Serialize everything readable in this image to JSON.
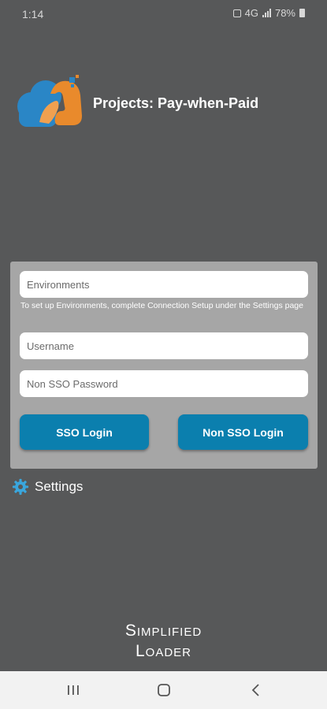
{
  "status_bar": {
    "time": "1:14",
    "signal_text": "4G",
    "battery": "78%"
  },
  "header": {
    "title": "Projects: Pay-when-Paid"
  },
  "login": {
    "environments_placeholder": "Environments",
    "hint": "To set up Environments, complete Connection Setup under the Settings page",
    "username_placeholder": "Username",
    "password_placeholder": "Non SSO Password",
    "sso_label": "SSO Login",
    "non_sso_label": "Non SSO Login"
  },
  "settings": {
    "label": "Settings"
  },
  "brand": {
    "line1": "Simplified",
    "line2": "Loader"
  },
  "colors": {
    "background": "#575859",
    "panel": "#a6a6a6",
    "button": "#0b7fae",
    "logo_blue": "#2a86c6",
    "logo_orange": "#e98a2c"
  }
}
